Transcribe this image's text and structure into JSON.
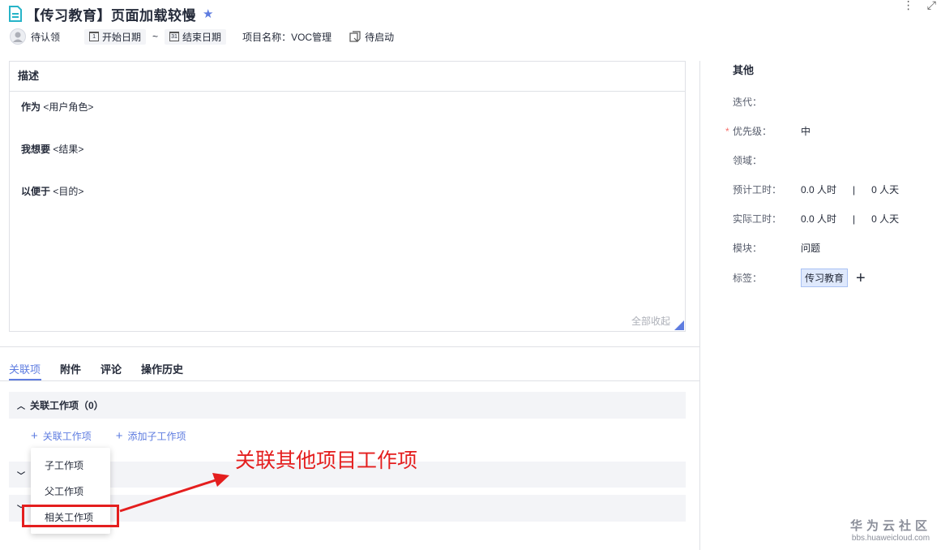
{
  "header": {
    "title": "【传习教育】页面加载较慢",
    "more_icon": "vertical-dots-icon",
    "expand_icon": "expand-icon"
  },
  "meta": {
    "assignee": "待认领",
    "start_date": "开始日期",
    "tilde": "~",
    "end_date": "结束日期",
    "project": "项目名称：VOC管理",
    "status": "待启动"
  },
  "description": {
    "title": "描述",
    "line1_bold": "作为",
    "line1_text": " <用户角色>",
    "line2_bold": "我想要",
    "line2_text": " <结果>",
    "line3_bold": "以便于",
    "line3_text": " <目的>",
    "collapse_all": "全部收起"
  },
  "sidebar": {
    "title": "其他",
    "iteration_label": "迭代：",
    "priority_label": "优先级：",
    "priority_value": "中",
    "domain_label": "领域：",
    "est_label": "预计工时：",
    "est_hours": "0.0 人时",
    "est_days": "0 人天",
    "actual_label": "实际工时：",
    "actual_hours": "0.0 人时",
    "actual_days": "0 人天",
    "module_label": "模块：",
    "module_value": "问题",
    "tags_label": "标签：",
    "tag_value": "传习教育",
    "sep": "|",
    "req": "*"
  },
  "tabs": [
    {
      "label": "关联项"
    },
    {
      "label": "附件"
    },
    {
      "label": "评论"
    },
    {
      "label": "操作历史"
    }
  ],
  "related": {
    "section_title": "关联工作项（0）",
    "link_related": "关联工作项",
    "link_add_child": "添加子工作项",
    "dropdown": [
      "子工作项",
      "父工作项",
      "相关工作项"
    ]
  },
  "annotation": "关联其他项目工作项",
  "watermark": {
    "cn": "华为云社区",
    "en": "bbs.huaweicloud.com"
  },
  "colors": {
    "accent": "#5e7ce0",
    "annotation_red": "#e41e1e",
    "doc_icon": "#27b4c8"
  }
}
